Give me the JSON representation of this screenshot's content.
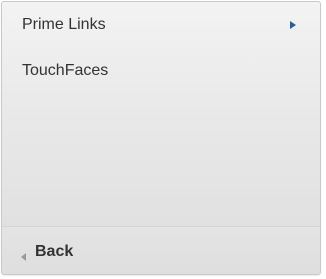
{
  "menu": {
    "items": [
      {
        "label": "Prime Links",
        "has_submenu": true,
        "arrow_icon": "chevron-right-icon"
      },
      {
        "label": "TouchFaces",
        "has_submenu": false
      }
    ]
  },
  "footer": {
    "back_label": "Back",
    "back_icon": "chevron-left-icon"
  },
  "colors": {
    "text": "#333333",
    "arrow_accent": "#2a5f93",
    "back_arrow": "#9a9a9a",
    "panel_border": "#c9c9c9"
  }
}
